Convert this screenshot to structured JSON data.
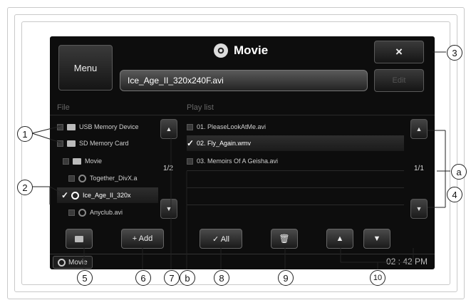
{
  "header": {
    "title": "Movie",
    "menu_label": "Menu",
    "close_label": "×",
    "edit_label": "Edit",
    "current_file": "Ice_Age_II_320x240F.avi"
  },
  "file_panel": {
    "heading": "File",
    "items": [
      {
        "label": "USB Memory Device",
        "icon": "usb-folder-icon"
      },
      {
        "label": "SD Memory Card",
        "icon": "sd-folder-icon"
      },
      {
        "label": "Movie",
        "icon": "folder-icon"
      },
      {
        "label": "Together_DivX.a",
        "icon": "film-reel-icon"
      },
      {
        "label": "Ice_Age_II_320x",
        "icon": "film-reel-icon",
        "checked": true
      },
      {
        "label": "Anyclub.avi",
        "icon": "film-reel-icon"
      }
    ],
    "page": "1/2"
  },
  "playlist_panel": {
    "heading": "Play list",
    "items": [
      {
        "label": "01. PleaseLookAtMe.avi"
      },
      {
        "label": "02. Fly_Again.wmv",
        "checked": true
      },
      {
        "label": "03. Memoirs Of A Geisha.avi"
      }
    ],
    "page": "1/1"
  },
  "bottom_bar": {
    "add_label": "+ Add",
    "all_label": "✓ All"
  },
  "status_bar": {
    "source_label": "Movie",
    "clock": "02 : 42 PM"
  },
  "callouts": [
    "1",
    "2",
    "3",
    "4",
    "5",
    "6",
    "7",
    "8",
    "9",
    "10",
    "a",
    "b"
  ]
}
